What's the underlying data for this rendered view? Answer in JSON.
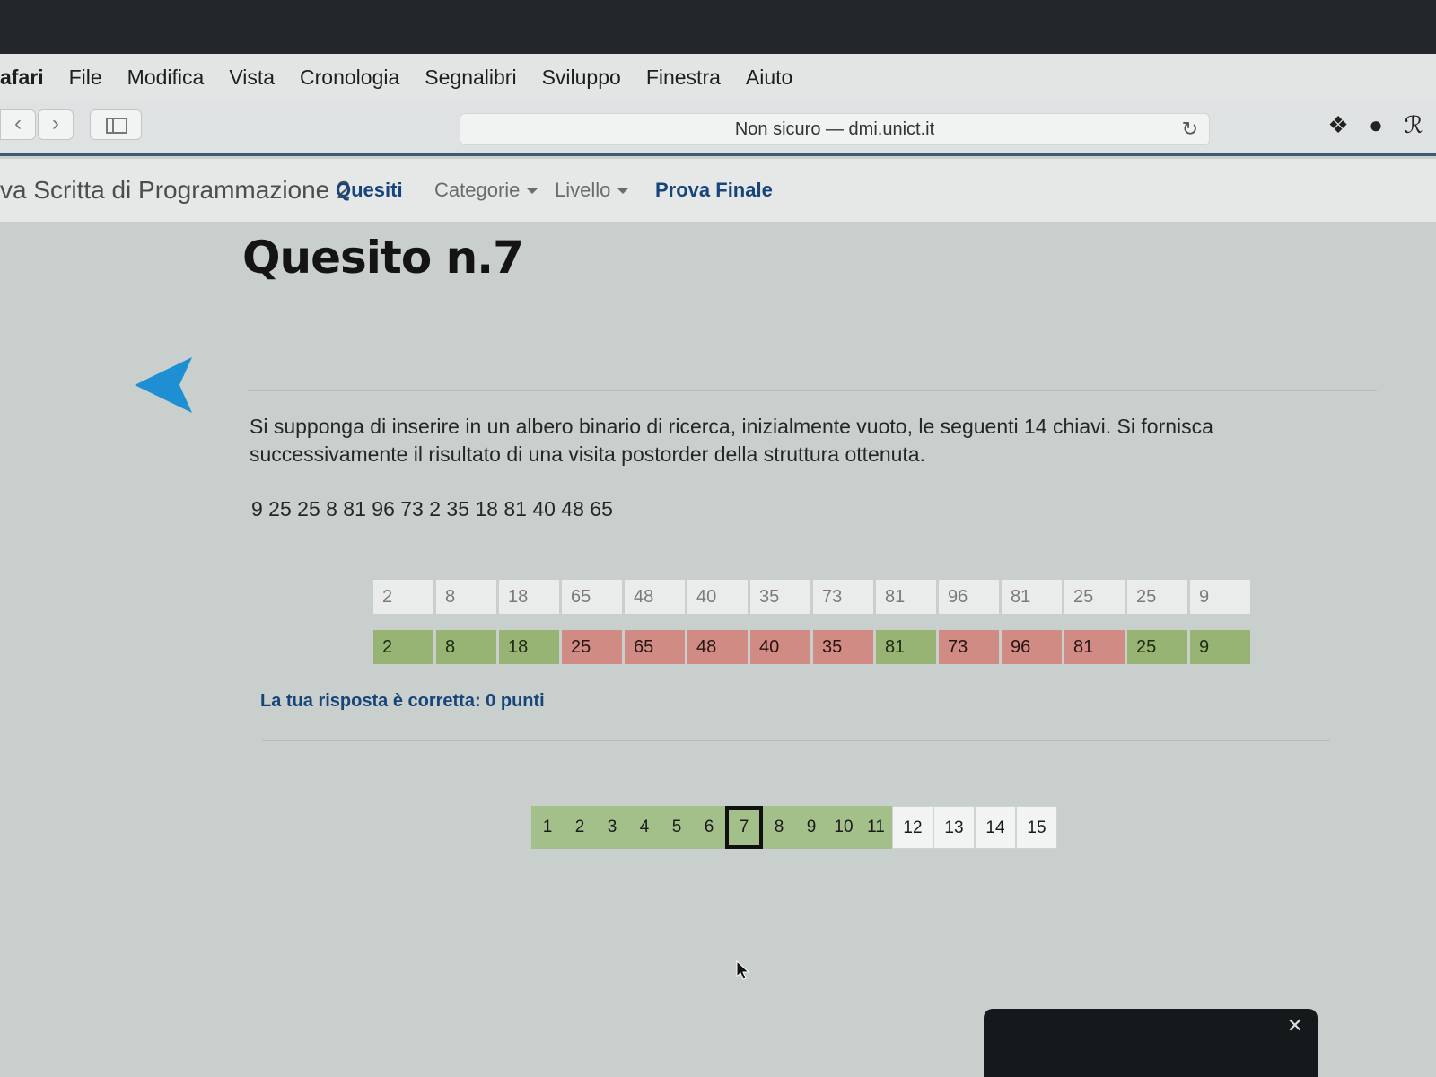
{
  "menubar": {
    "app_name": "afari",
    "items": [
      "File",
      "Modifica",
      "Vista",
      "Cronologia",
      "Segnalibri",
      "Sviluppo",
      "Finestra",
      "Aiuto"
    ]
  },
  "toolbar": {
    "address": "Non sicuro — dmi.unict.it",
    "icons": [
      "dropbox-icon",
      "check-shield-icon",
      "script-icon"
    ]
  },
  "sitenav": {
    "brand": "va Scritta di Programmazione 2",
    "quesiti": "Quesiti",
    "categorie": "Categorie",
    "livello": "Livello",
    "prova_finale": "Prova Finale"
  },
  "main": {
    "title": "Quesito n.7",
    "question": "Si supponga di inserire in un albero binario di ricerca, inizialmente vuoto, le seguenti 14 chiavi. Si fornisca successivamente il risultato di una visita postorder della struttura ottenuta.",
    "keys": "9 25 25 8 81 96 73 2 35 18 81 40 48 65",
    "answer_row": [
      "2",
      "8",
      "18",
      "65",
      "48",
      "40",
      "35",
      "73",
      "81",
      "96",
      "81",
      "25",
      "25",
      "9"
    ],
    "solution_row": [
      {
        "value": "2",
        "status": "ok"
      },
      {
        "value": "8",
        "status": "ok"
      },
      {
        "value": "18",
        "status": "ok"
      },
      {
        "value": "25",
        "status": "bad"
      },
      {
        "value": "65",
        "status": "bad"
      },
      {
        "value": "48",
        "status": "bad"
      },
      {
        "value": "40",
        "status": "bad"
      },
      {
        "value": "35",
        "status": "bad"
      },
      {
        "value": "81",
        "status": "ok"
      },
      {
        "value": "73",
        "status": "bad"
      },
      {
        "value": "96",
        "status": "bad"
      },
      {
        "value": "81",
        "status": "bad"
      },
      {
        "value": "25",
        "status": "ok"
      },
      {
        "value": "9",
        "status": "ok"
      }
    ],
    "result": "La tua risposta è corretta: 0 punti"
  },
  "pager": {
    "pages": [
      {
        "label": "1",
        "state": "visited"
      },
      {
        "label": "2",
        "state": "visited"
      },
      {
        "label": "3",
        "state": "visited"
      },
      {
        "label": "4",
        "state": "visited"
      },
      {
        "label": "5",
        "state": "visited"
      },
      {
        "label": "6",
        "state": "visited"
      },
      {
        "label": "7",
        "state": "current"
      },
      {
        "label": "8",
        "state": "visited"
      },
      {
        "label": "9",
        "state": "visited"
      },
      {
        "label": "10",
        "state": "visited"
      },
      {
        "label": "11",
        "state": "visited"
      },
      {
        "label": "12",
        "state": "fresh"
      },
      {
        "label": "13",
        "state": "fresh"
      },
      {
        "label": "14",
        "state": "fresh"
      },
      {
        "label": "15",
        "state": "fresh"
      }
    ]
  },
  "colors": {
    "correct": "#97b474",
    "wrong": "#cf8b84",
    "accent": "#17447a",
    "arrow": "#1e8fd2"
  },
  "notification": {
    "close": "✕"
  }
}
